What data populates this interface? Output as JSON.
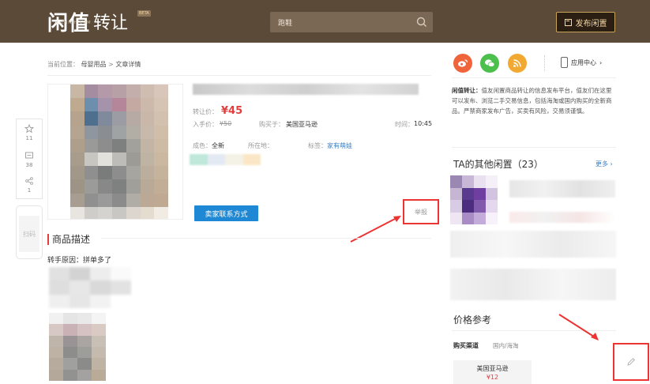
{
  "header": {
    "logo_text_1": "闲值",
    "logo_text_2": "转让",
    "logo_beta": "BETA",
    "logo_sub": "X·ZHIDH.COM",
    "search_placeholder": "跑鞋",
    "publish_label": "发布闲置"
  },
  "breadcrumb": {
    "prefix": "当前位置：",
    "items": [
      "母婴用品",
      "文章详情"
    ],
    "separator": ">"
  },
  "side_tools": {
    "fav_count": "11",
    "comment_count": "38",
    "share_count": "1",
    "qr_label": "扫码"
  },
  "item": {
    "price_label": "转让价：",
    "price": "¥45",
    "buy_price_label": "入手价：",
    "buy_price": "¥50",
    "buy_from_label": "购买于：",
    "buy_from": "美国亚马逊",
    "time_label": "时间：",
    "time": "10:45",
    "condition_label": "成色：",
    "condition": "全新",
    "location_label": "所在地：",
    "tag_label": "标签：",
    "tag": "家有萌娃",
    "contact_button": "卖家联系方式",
    "report_label": "举报"
  },
  "description": {
    "title": "商品描述",
    "reason": "转手原因：拼单多了"
  },
  "right": {
    "app_center": "应用中心",
    "intro_bold": "闲值转让：",
    "intro_text": "值友闲置商品转让的信息发布平台，值友们在这里可以发布、浏览二手交易信息，包括海淘或国内购买的全新商品。严禁商家发布广告，买卖有风险，交易须谨慎。",
    "other_title": "TA的其他闲置（23）",
    "more_label": "更多",
    "price_ref_title": "价格参考",
    "channel_label": "购买渠道",
    "channel_sub": "国内/海淘",
    "ref_store": "美国亚马逊",
    "ref_price": "¥12"
  },
  "colors": {
    "header_bg": "#5b4a38",
    "accent_red": "#e43d3d",
    "button_blue": "#1e88d4",
    "link_blue": "#3b7fc4",
    "annotation_red": "#e33333"
  }
}
